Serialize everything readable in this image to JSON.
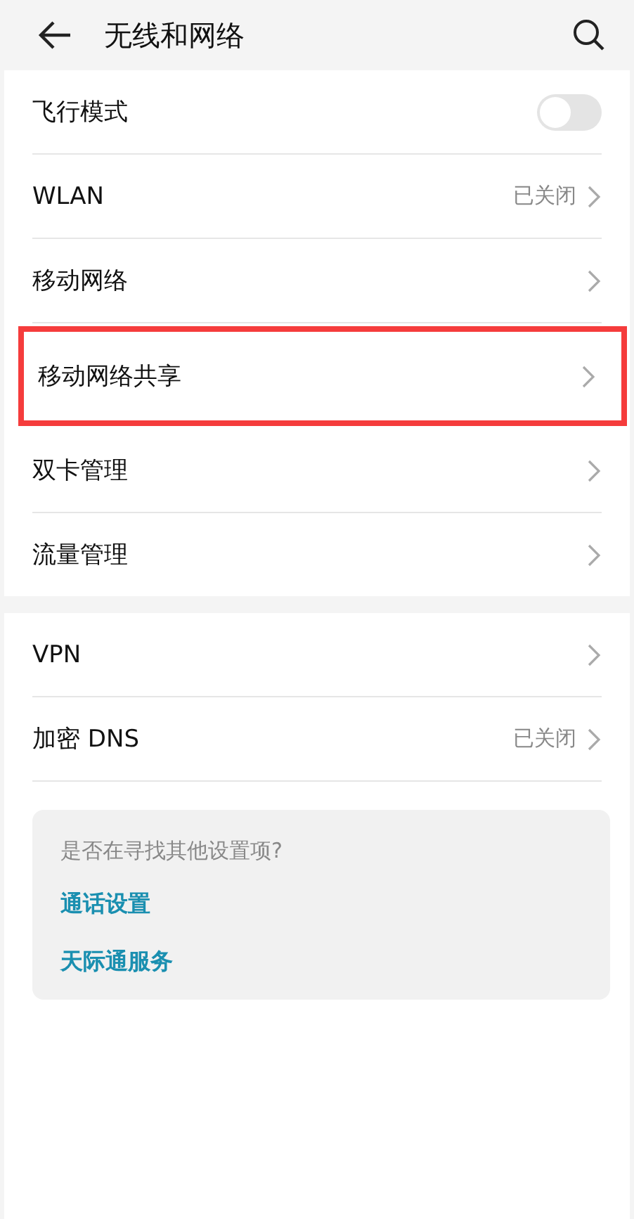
{
  "header": {
    "title": "无线和网络"
  },
  "groups": [
    {
      "rows": [
        {
          "kind": "toggle",
          "label": "飞行模式",
          "on": false,
          "highlighted": false
        },
        {
          "kind": "link",
          "label": "WLAN",
          "value": "已关闭",
          "highlighted": false
        },
        {
          "kind": "link",
          "label": "移动网络",
          "highlighted": false
        },
        {
          "kind": "link",
          "label": "移动网络共享",
          "highlighted": true
        },
        {
          "kind": "link",
          "label": "双卡管理",
          "highlighted": false
        },
        {
          "kind": "link",
          "label": "流量管理",
          "highlighted": false
        }
      ]
    },
    {
      "rows": [
        {
          "kind": "link",
          "label": "VPN",
          "highlighted": false
        },
        {
          "kind": "link",
          "label": "加密 DNS",
          "value": "已关闭",
          "highlighted": false
        }
      ]
    }
  ],
  "suggestions": {
    "question": "是否在寻找其他设置项?",
    "links": [
      "通话设置",
      "天际通服务"
    ]
  }
}
